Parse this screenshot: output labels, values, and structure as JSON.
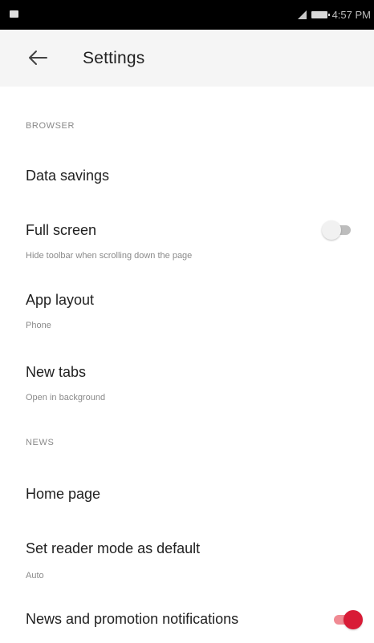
{
  "status_bar": {
    "time": "4:57 PM",
    "time_display": "4:57 PM"
  },
  "app_bar": {
    "title": "Settings"
  },
  "sections": {
    "browser": "BROWSER",
    "news": "NEWS"
  },
  "items": [
    {
      "title": "Data savings",
      "subtitle": ""
    },
    {
      "title": "Full screen",
      "subtitle": "Hide toolbar when scrolling down the page",
      "toggle": false
    },
    {
      "title": "App layout",
      "subtitle": "Phone"
    },
    {
      "title": "New tabs",
      "subtitle": "Open in background"
    },
    {
      "title": "Home page",
      "subtitle": ""
    },
    {
      "title": "Set reader mode as default",
      "subtitle": "Auto"
    },
    {
      "title": "News and promotion notifications",
      "subtitle": "",
      "toggle": true
    }
  ],
  "colors": {
    "accent": "#d81b36",
    "app_bar_bg": "#f5f5f5",
    "status_bar_bg": "#000000"
  }
}
